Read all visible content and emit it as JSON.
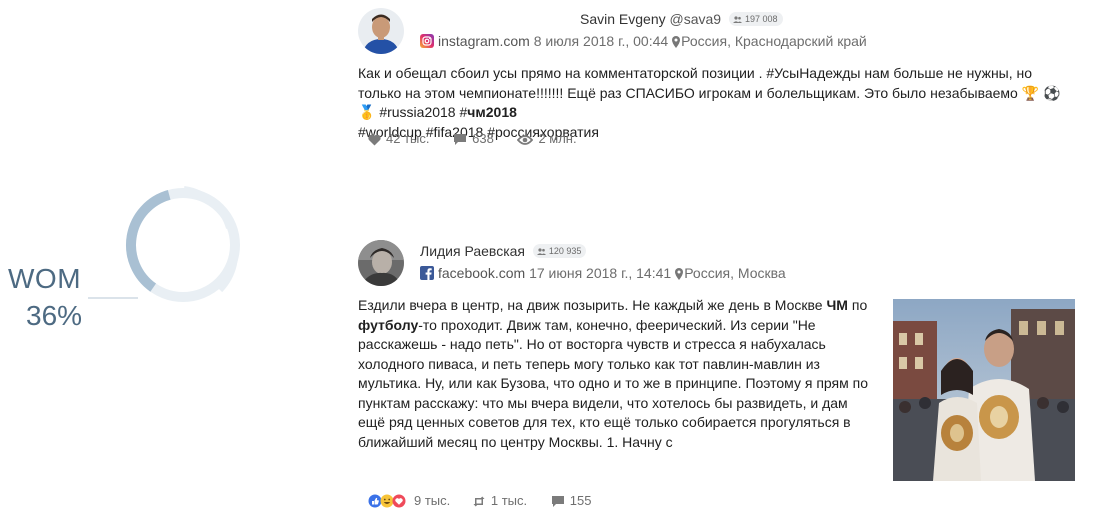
{
  "wom": {
    "label": "WOM",
    "value": "36%",
    "fraction": 0.36
  },
  "posts": [
    {
      "author": "Savin Evgeny",
      "handle": "@sava9",
      "followers": "197 008",
      "source": "instagram.com",
      "source_icon": "instagram-icon",
      "date": "8 июля 2018 г., 00:44",
      "location": "Россия, Краснодарский край",
      "text": {
        "p1": "Как и обещал сбоил усы прямо на комментаторской позиции . #УсыНадежды нам больше не нужны, но только на этом чемпионате!!!!!!! Ещё раз СПАСИБО игрокам и болельщикам. Это было незабываемо 🏆 ⚽ 🥇  #russia2018 #",
        "bold": "чм2018",
        "p2": "#worldcup #fifa2018 #россияхорватия"
      },
      "stats": {
        "likes": "42 тыс.",
        "comments": "638",
        "views": "2 млн."
      }
    },
    {
      "author": "Лидия Раевская",
      "followers": "120 935",
      "source": "facebook.com",
      "source_icon": "facebook-icon",
      "date": "17 июня 2018 г., 14:41",
      "location": "Россия, Москва",
      "text": {
        "s1": "Ездили вчера в центр, на движ позырить. Не каждый же день в Москве ",
        "b1": "ЧМ",
        "s2": " по ",
        "b2": "футболу",
        "s3": "-то проходит. Движ там, конечно, феерический. Из серии \"Не расскажешь - надо петь\". Но от восторга чувств и стресса я набухалась холодного пиваса, и петь теперь могу только как тот павлин-мавлин из мультика. Ну, или как Бузова, что одно и то же в принципе. Поэтому я прям по пунктам расскажу: что мы вчера видели, что хотелось бы развидеть, и дам ещё ряд ценных советов для тех, кто ещё только собирается прогуляться в ближайший месяц по центру Москвы. 1. Начну с"
      },
      "stats": {
        "reactions": "9 тыс.",
        "shares": "1 тыс.",
        "comments": "155"
      }
    }
  ],
  "colors": {
    "donut_fill": "#a9c0d3",
    "donut_track": "#e9eff4",
    "wom_text": "#4d6a82",
    "facebook_blue": "#3b5998"
  }
}
